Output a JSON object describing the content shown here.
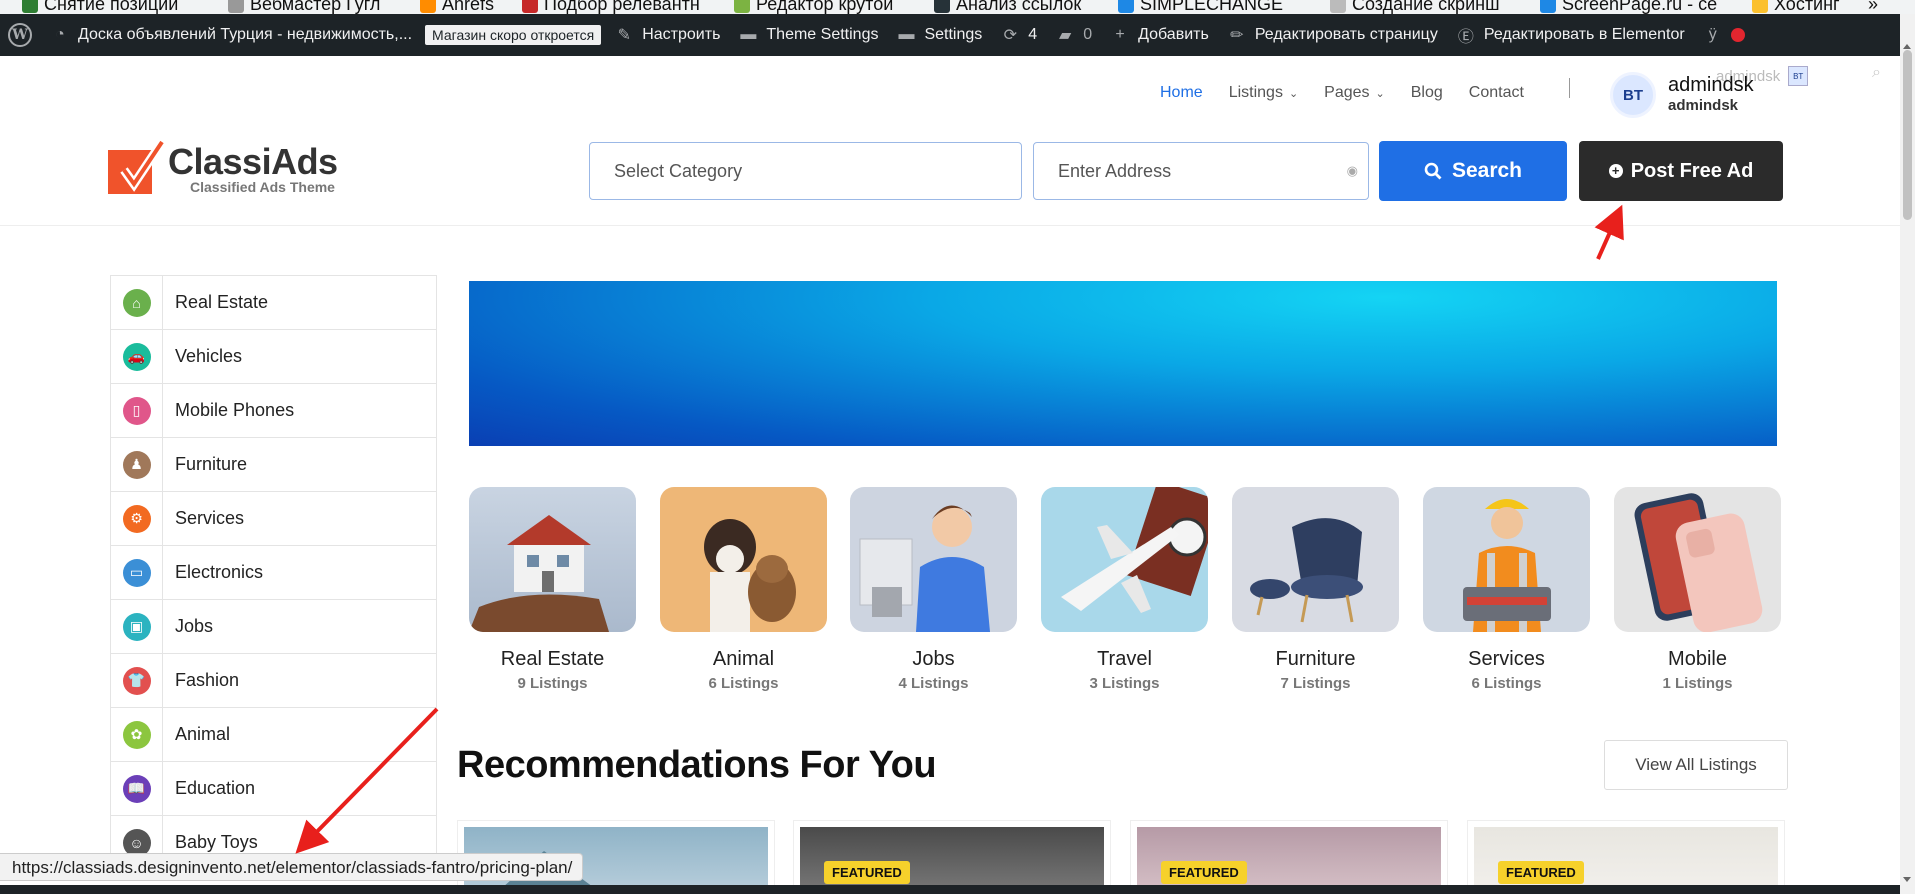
{
  "colors": {
    "accent_blue": "#1f6fe5",
    "dark_button": "#2b2b2b",
    "admin_bar": "#1d2327",
    "arrow_red": "#e8201c",
    "featured_yellow": "#f6d12b"
  },
  "bookmarks": [
    {
      "label": "Снятие позиций",
      "color": "#2e7d32"
    },
    {
      "label": "Вебмастер Гугл",
      "color": "#999"
    },
    {
      "label": "Ahrefs",
      "color": "#ff8c00"
    },
    {
      "label": "Подбор релевантн",
      "color": "#c62828"
    },
    {
      "label": "Редактор крутой",
      "color": "#7cb342"
    },
    {
      "label": "Анализ ссылок",
      "color": "#263238"
    },
    {
      "label": "SIMPLECHANGE",
      "color": "#1e88e5"
    },
    {
      "label": "Создание скринш",
      "color": "#bbb"
    },
    {
      "label": "ScreenPage.ru - се",
      "color": "#1e88e5"
    },
    {
      "label": "Хостинг",
      "color": "#fbc02d"
    }
  ],
  "adminbar": {
    "site_name": "Доска объявлений Турция - недвижимость,...",
    "store_badge": "Магазин скоро откроется",
    "customize": "Настроить",
    "theme_settings": "Theme Settings",
    "settings": "Settings",
    "updates_count": "4",
    "comments_count": "0",
    "add_new": "Добавить",
    "edit_page": "Редактировать страницу",
    "edit_elementor": "Редактировать в Elementor"
  },
  "header": {
    "nav": [
      {
        "label": "Home",
        "active": true,
        "dropdown": false
      },
      {
        "label": "Listings",
        "active": false,
        "dropdown": true
      },
      {
        "label": "Pages",
        "active": false,
        "dropdown": true
      },
      {
        "label": "Blog",
        "active": false,
        "dropdown": false
      },
      {
        "label": "Contact",
        "active": false,
        "dropdown": false
      }
    ],
    "user": {
      "initials": "BT",
      "name": "admindsk",
      "sub": "admindsk"
    },
    "ghost_user": "admindsk",
    "logo": {
      "name": "ClassiAds",
      "tagline": "Classified Ads Theme"
    },
    "search": {
      "category_placeholder": "Select Category",
      "address_placeholder": "Enter Address",
      "search_label": "Search",
      "post_label": "Post Free Ad"
    }
  },
  "sidebar": {
    "items": [
      {
        "label": "Real Estate",
        "icon": "home-icon",
        "color": "#6ab04c",
        "glyph": "⌂"
      },
      {
        "label": "Vehicles",
        "icon": "car-icon",
        "color": "#1abc9c",
        "glyph": "🚗"
      },
      {
        "label": "Mobile Phones",
        "icon": "phone-icon",
        "color": "#e0568a",
        "glyph": "▯"
      },
      {
        "label": "Furniture",
        "icon": "furniture-icon",
        "color": "#a0785a",
        "glyph": "♟"
      },
      {
        "label": "Services",
        "icon": "gear-icon",
        "color": "#f26a21",
        "glyph": "⚙"
      },
      {
        "label": "Electronics",
        "icon": "monitor-icon",
        "color": "#3b8fd6",
        "glyph": "▭"
      },
      {
        "label": "Jobs",
        "icon": "briefcase-icon",
        "color": "#2bb3c0",
        "glyph": "▣"
      },
      {
        "label": "Fashion",
        "icon": "shirt-icon",
        "color": "#e2504f",
        "glyph": "👕"
      },
      {
        "label": "Animal",
        "icon": "paw-icon",
        "color": "#8cc63f",
        "glyph": "✿"
      },
      {
        "label": "Education",
        "icon": "book-icon",
        "color": "#6b3fb8",
        "glyph": "📖"
      },
      {
        "label": "Baby Toys",
        "icon": "toy-icon",
        "color": "#555555",
        "glyph": "☺"
      }
    ]
  },
  "categories": [
    {
      "name": "Real Estate",
      "count": "9 Listings",
      "icon": "house-image"
    },
    {
      "name": "Animal",
      "count": "6 Listings",
      "icon": "animal-image"
    },
    {
      "name": "Jobs",
      "count": "4 Listings",
      "icon": "jobs-image"
    },
    {
      "name": "Travel",
      "count": "3 Listings",
      "icon": "travel-image"
    },
    {
      "name": "Furniture",
      "count": "7 Listings",
      "icon": "furniture-image"
    },
    {
      "name": "Services",
      "count": "6 Listings",
      "icon": "services-image"
    },
    {
      "name": "Mobile",
      "count": "1 Listings",
      "icon": "mobile-image"
    }
  ],
  "recommendations": {
    "title": "Recommendations For You",
    "view_all": "View All Listings",
    "badge": "FEATURED"
  },
  "status_url": "https://classiads.designinvento.net/elementor/classiads-fantro/pricing-plan/"
}
